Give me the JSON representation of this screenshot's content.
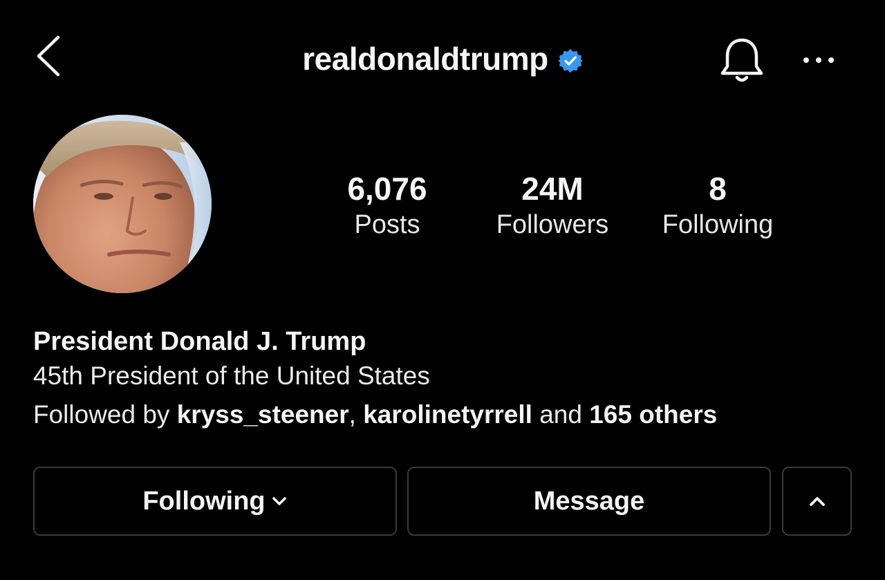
{
  "header": {
    "username": "realdonaldtrump",
    "back_icon": "chevron-left-icon",
    "verified_icon": "verified-badge-icon",
    "notification_icon": "bell-icon",
    "more_icon": "more-horizontal-icon"
  },
  "stats": {
    "posts": {
      "value": "6,076",
      "label": "Posts"
    },
    "followers": {
      "value": "24M",
      "label": "Followers"
    },
    "following": {
      "value": "8",
      "label": "Following"
    }
  },
  "bio": {
    "name": "President Donald J. Trump",
    "description": "45th President of the United States",
    "followed_by_prefix": "Followed by ",
    "followed_by_user1": "kryss_steener",
    "separator": ", ",
    "followed_by_user2": "karolinetyrrell",
    "and_text": " and ",
    "others": "165 others"
  },
  "buttons": {
    "following": "Following",
    "message": "Message"
  },
  "colors": {
    "background": "#000000",
    "text": "#f5f5f5",
    "verified": "#3897f0",
    "button_border": "#3a3a3a"
  }
}
